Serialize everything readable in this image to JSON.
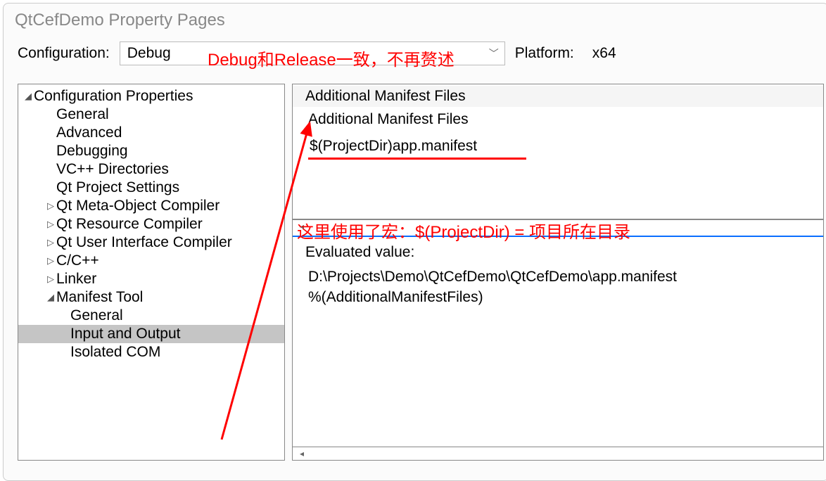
{
  "window": {
    "title": "QtCefDemo Property Pages"
  },
  "annotations": {
    "top": "Debug和Release一致，不再赘述",
    "macro": "这里使用了宏：$(ProjectDir)  =  项目所在目录"
  },
  "config": {
    "label": "Configuration:",
    "value": "Debug",
    "platform_label": "Platform:",
    "platform_value": "x64"
  },
  "tree": {
    "root": "Configuration Properties",
    "items": [
      {
        "label": "General",
        "level": 1,
        "exp": ""
      },
      {
        "label": "Advanced",
        "level": 1,
        "exp": ""
      },
      {
        "label": "Debugging",
        "level": 1,
        "exp": ""
      },
      {
        "label": "VC++ Directories",
        "level": 1,
        "exp": ""
      },
      {
        "label": "Qt Project Settings",
        "level": 1,
        "exp": ""
      },
      {
        "label": "Qt Meta-Object Compiler",
        "level": 1,
        "exp": "▷"
      },
      {
        "label": "Qt Resource Compiler",
        "level": 1,
        "exp": "▷"
      },
      {
        "label": "Qt User Interface Compiler",
        "level": 1,
        "exp": "▷"
      },
      {
        "label": "C/C++",
        "level": 1,
        "exp": "▷"
      },
      {
        "label": "Linker",
        "level": 1,
        "exp": "▷"
      },
      {
        "label": "Manifest Tool",
        "level": 1,
        "exp": "◢"
      },
      {
        "label": "General",
        "level": 2,
        "exp": ""
      },
      {
        "label": "Input and Output",
        "level": 2,
        "exp": "",
        "selected": true
      },
      {
        "label": "Isolated COM",
        "level": 2,
        "exp": ""
      }
    ]
  },
  "property": {
    "header": "Additional Manifest Files",
    "name": "Additional Manifest Files",
    "input_value": "$(ProjectDir)app.manifest",
    "evaluated_label": "Evaluated value:",
    "evaluated_value": "D:\\Projects\\Demo\\QtCefDemo\\QtCefDemo\\app.manifest\n%(AdditionalManifestFiles)"
  }
}
